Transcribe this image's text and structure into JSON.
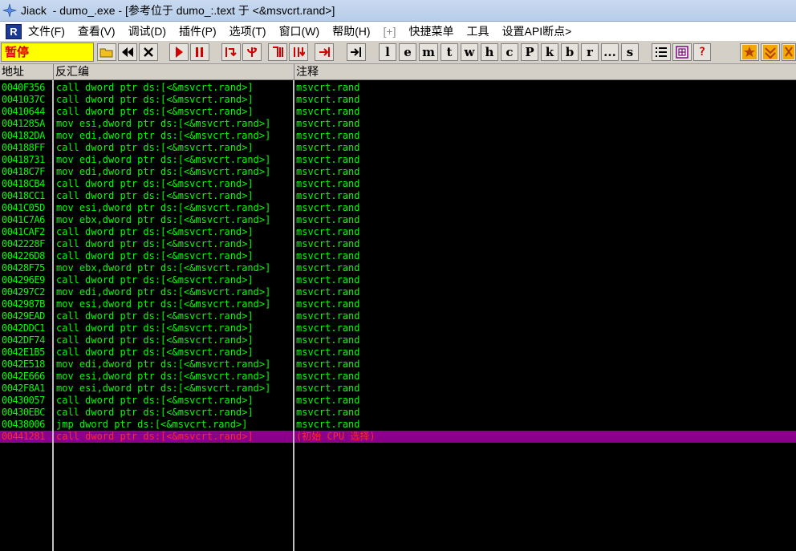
{
  "window": {
    "app_name": "Jiack",
    "title_rest": "  - dumo_.exe - [参考位于 dumo_:.text 于 <&msvcrt.rand>]"
  },
  "menu": {
    "items": [
      "文件(F)",
      "查看(V)",
      "调试(D)",
      "插件(P)",
      "选项(T)",
      "窗口(W)",
      "帮助(H)",
      "[+]",
      "快捷菜单",
      "工具",
      "设置API断点>"
    ]
  },
  "toolbar": {
    "status": "暂停",
    "letters": [
      "l",
      "e",
      "m",
      "t",
      "w",
      "h",
      "c",
      "P",
      "k",
      "b",
      "r",
      "...",
      "s"
    ]
  },
  "columns": {
    "address": "地址",
    "disasm": "反汇编",
    "comment": "注释"
  },
  "rows": [
    {
      "addr": "0040F356",
      "asm": "call dword ptr ds:[<&msvcrt.rand>]",
      "cmt": "msvcrt.rand"
    },
    {
      "addr": "0041037C",
      "asm": "call dword ptr ds:[<&msvcrt.rand>]",
      "cmt": "msvcrt.rand"
    },
    {
      "addr": "00410644",
      "asm": "call dword ptr ds:[<&msvcrt.rand>]",
      "cmt": "msvcrt.rand"
    },
    {
      "addr": "0041285A",
      "asm": "mov esi,dword ptr ds:[<&msvcrt.rand>]",
      "cmt": "msvcrt.rand"
    },
    {
      "addr": "004182DA",
      "asm": "mov edi,dword ptr ds:[<&msvcrt.rand>]",
      "cmt": "msvcrt.rand"
    },
    {
      "addr": "004188FF",
      "asm": "call dword ptr ds:[<&msvcrt.rand>]",
      "cmt": "msvcrt.rand"
    },
    {
      "addr": "00418731",
      "asm": "mov edi,dword ptr ds:[<&msvcrt.rand>]",
      "cmt": "msvcrt.rand"
    },
    {
      "addr": "00418C7F",
      "asm": "mov edi,dword ptr ds:[<&msvcrt.rand>]",
      "cmt": "msvcrt.rand"
    },
    {
      "addr": "00418CB4",
      "asm": "call dword ptr ds:[<&msvcrt.rand>]",
      "cmt": "msvcrt.rand"
    },
    {
      "addr": "00418CC1",
      "asm": "call dword ptr ds:[<&msvcrt.rand>]",
      "cmt": "msvcrt.rand"
    },
    {
      "addr": "0041C05D",
      "asm": "mov esi,dword ptr ds:[<&msvcrt.rand>]",
      "cmt": "msvcrt.rand"
    },
    {
      "addr": "0041C7A6",
      "asm": "mov ebx,dword ptr ds:[<&msvcrt.rand>]",
      "cmt": "msvcrt.rand"
    },
    {
      "addr": "0041CAF2",
      "asm": "call dword ptr ds:[<&msvcrt.rand>]",
      "cmt": "msvcrt.rand"
    },
    {
      "addr": "0042228F",
      "asm": "call dword ptr ds:[<&msvcrt.rand>]",
      "cmt": "msvcrt.rand"
    },
    {
      "addr": "004226D8",
      "asm": "call dword ptr ds:[<&msvcrt.rand>]",
      "cmt": "msvcrt.rand"
    },
    {
      "addr": "00428F75",
      "asm": "mov ebx,dword ptr ds:[<&msvcrt.rand>]",
      "cmt": "msvcrt.rand"
    },
    {
      "addr": "004296E9",
      "asm": "call dword ptr ds:[<&msvcrt.rand>]",
      "cmt": "msvcrt.rand"
    },
    {
      "addr": "004297C2",
      "asm": "mov edi,dword ptr ds:[<&msvcrt.rand>]",
      "cmt": "msvcrt.rand"
    },
    {
      "addr": "0042987B",
      "asm": "mov esi,dword ptr ds:[<&msvcrt.rand>]",
      "cmt": "msvcrt.rand"
    },
    {
      "addr": "00429EAD",
      "asm": "call dword ptr ds:[<&msvcrt.rand>]",
      "cmt": "msvcrt.rand"
    },
    {
      "addr": "0042DDC1",
      "asm": "call dword ptr ds:[<&msvcrt.rand>]",
      "cmt": "msvcrt.rand"
    },
    {
      "addr": "0042DF74",
      "asm": "call dword ptr ds:[<&msvcrt.rand>]",
      "cmt": "msvcrt.rand"
    },
    {
      "addr": "0042E1B5",
      "asm": "call dword ptr ds:[<&msvcrt.rand>]",
      "cmt": "msvcrt.rand"
    },
    {
      "addr": "0042E518",
      "asm": "mov edi,dword ptr ds:[<&msvcrt.rand>]",
      "cmt": "msvcrt.rand"
    },
    {
      "addr": "0042E666",
      "asm": "mov esi,dword ptr ds:[<&msvcrt.rand>]",
      "cmt": "msvcrt.rand"
    },
    {
      "addr": "0042F8A1",
      "asm": "mov esi,dword ptr ds:[<&msvcrt.rand>]",
      "cmt": "msvcrt.rand"
    },
    {
      "addr": "00430057",
      "asm": "call dword ptr ds:[<&msvcrt.rand>]",
      "cmt": "msvcrt.rand"
    },
    {
      "addr": "00430EBC",
      "asm": "call dword ptr ds:[<&msvcrt.rand>]",
      "cmt": "msvcrt.rand"
    },
    {
      "addr": "00438006",
      "asm": "jmp dword ptr ds:[<&msvcrt.rand>]",
      "cmt": "msvcrt.rand"
    },
    {
      "addr": "00441281",
      "asm": "call dword ptr ds:[<&msvcrt.rand>]",
      "cmt": "(初始 CPU 选择)",
      "selected": true
    }
  ]
}
